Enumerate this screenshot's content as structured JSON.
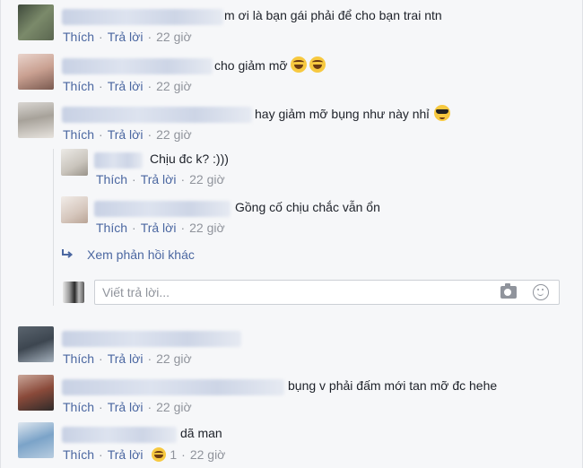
{
  "actions": {
    "like": "Thích",
    "reply": "Trả lời",
    "sep": "·"
  },
  "comments": [
    {
      "text": "m ơi là bạn gái phải để cho bạn trai ntn",
      "time": "22 giờ"
    },
    {
      "text": "cho giảm mỡ",
      "emoji": [
        "laughing-emoji",
        "laughing-emoji"
      ],
      "time": "22 giờ"
    },
    {
      "text": "hay giảm mỡ bụng như này nhỉ",
      "emoji": [
        "cool-emoji"
      ],
      "time": "22 giờ"
    },
    {
      "text": "",
      "time": "22 giờ"
    },
    {
      "text": "bụng v phải đấm mới tan mỡ đc hehe",
      "time": "22 giờ"
    },
    {
      "text": "dã man",
      "time": "22 giờ",
      "reaction_count": "1"
    }
  ],
  "replies": [
    {
      "text": "Chịu đc k? :)))",
      "time": "22 giờ"
    },
    {
      "text": "Gồng cố chịu chắc vẫn ổn",
      "time": "22 giờ"
    }
  ],
  "more_replies": "Xem phản hồi khác",
  "reply_box": {
    "placeholder": "Viết trả lời..."
  },
  "icons": {
    "camera": "camera-icon",
    "emoji": "smiley-icon",
    "reply_arrow": "reply-arrow-icon"
  }
}
